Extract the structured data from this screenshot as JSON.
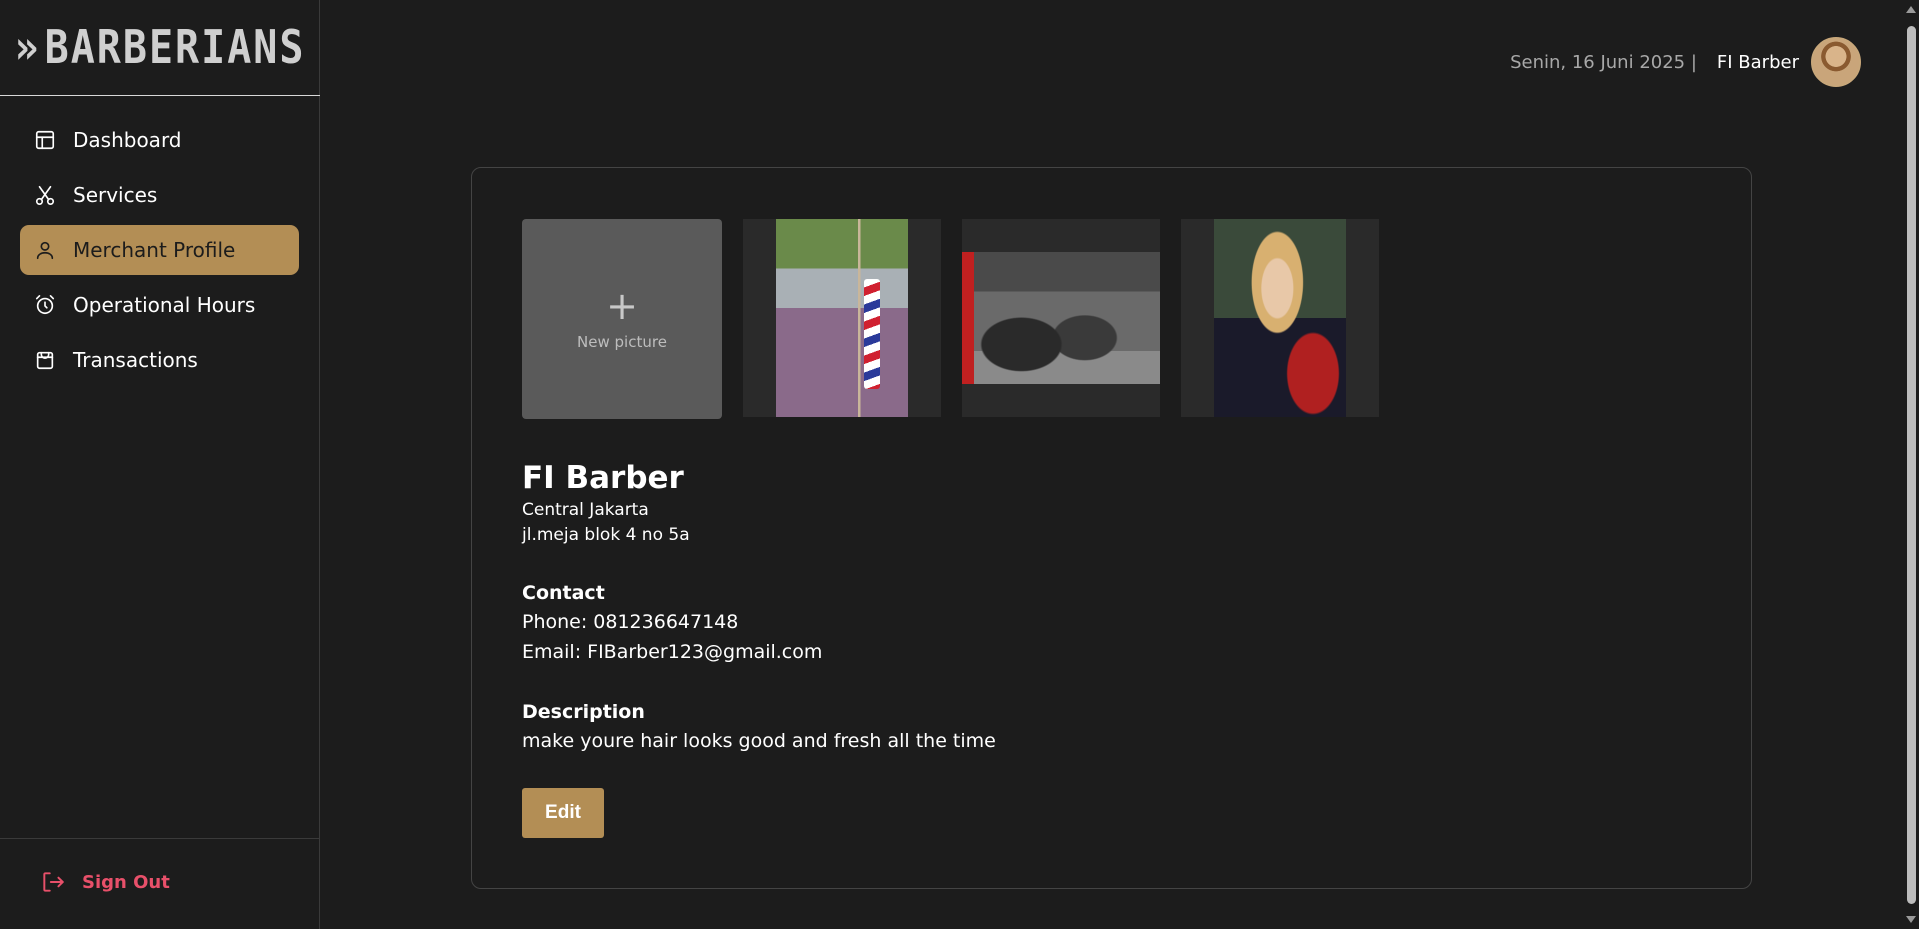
{
  "brand": {
    "logo_text": "BARBERIANS",
    "logo_icon": "scissors-arrow-mark"
  },
  "sidebar": {
    "items": [
      {
        "label": "Dashboard",
        "icon": "layout-icon",
        "active": false
      },
      {
        "label": "Services",
        "icon": "scissors-icon",
        "active": false
      },
      {
        "label": "Merchant Profile",
        "icon": "user-icon",
        "active": true
      },
      {
        "label": "Operational Hours",
        "icon": "alarm-clock-icon",
        "active": false
      },
      {
        "label": "Transactions",
        "icon": "shopping-bag-icon",
        "active": false
      }
    ],
    "signout_label": "Sign Out"
  },
  "header": {
    "date": "Senin, 16 Juni 2025 |",
    "user_name": "FI Barber"
  },
  "profile": {
    "gallery": {
      "new_picture_label": "New picture",
      "photos": [
        "barber-pole-photo",
        "barbershop-interior-photo",
        "woman-in-barber-chair-photo"
      ]
    },
    "name": "FI Barber",
    "city": "Central Jakarta",
    "address": "jl.meja blok 4 no 5a",
    "contact_heading": "Contact",
    "phone": "Phone: 081236647148",
    "email": "Email: FIBarber123@gmail.com",
    "description_heading": "Description",
    "description": "make youre hair looks good and fresh all the time",
    "edit_label": "Edit"
  },
  "colors": {
    "accent": "#b38e55",
    "background": "#1c1c1c",
    "signout": "#e8506a"
  }
}
